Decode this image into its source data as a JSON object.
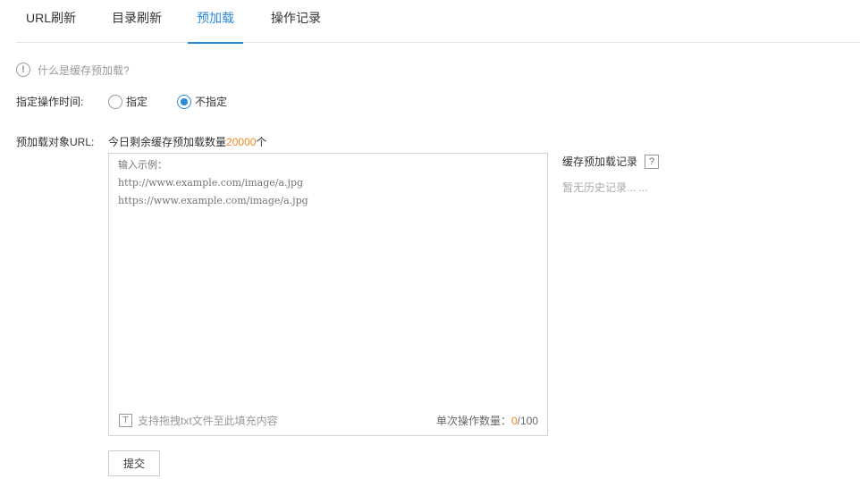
{
  "tabs": [
    {
      "label": "URL刷新"
    },
    {
      "label": "目录刷新"
    },
    {
      "label": "预加载",
      "active": true
    },
    {
      "label": "操作记录"
    }
  ],
  "help": {
    "icon": "exclamation-circle-icon",
    "text": "什么是缓存预加载?"
  },
  "time": {
    "label": "指定操作时间:",
    "options": [
      "指定",
      "不指定"
    ],
    "selected": "不指定"
  },
  "urls": {
    "label": "预加载对象URL:",
    "quota_prefix": "今日剩余缓存预加载数量",
    "quota_value": "20000",
    "quota_suffix": "个",
    "placeholder": "输入示例：\nhttp://www.example.com/image/a.jpg\nhttps://www.example.com/image/a.jpg",
    "drag_tip": "支持拖拽txt文件至此填充内容",
    "count_label": "单次操作数量：",
    "count_current": "0",
    "count_max": "/100",
    "submit_label": "提交"
  },
  "history": {
    "title": "缓存预加载记录",
    "help_icon_text": "?",
    "empty_text": "暂无历史记录... ..."
  },
  "colors": {
    "accent": "#2a8ad9",
    "highlight": "#f08a24"
  }
}
